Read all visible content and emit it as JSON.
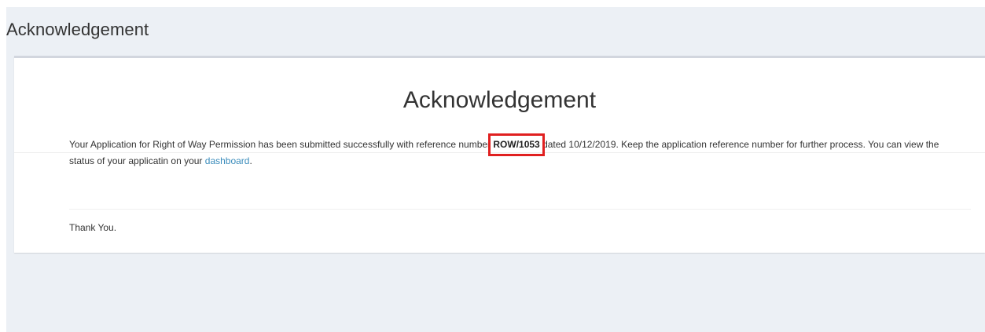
{
  "header": {
    "title": "Acknowledgement"
  },
  "box": {
    "title": "Acknowledgement",
    "message_before": "Your Application for Right of Way Permission has been submitted successfully with reference number ",
    "reference_number": "ROW/1053",
    "message_after": " dated 10/12/2019. Keep the application reference number for further process. You can view the status of your applicatin on your ",
    "dashboard_link": "dashboard",
    "message_end": ".",
    "thanks": "Thank You."
  },
  "colors": {
    "page_background": "#ecf0f5",
    "box_background": "#ffffff",
    "link": "#3c8dbc",
    "highlight": "#e02020"
  }
}
